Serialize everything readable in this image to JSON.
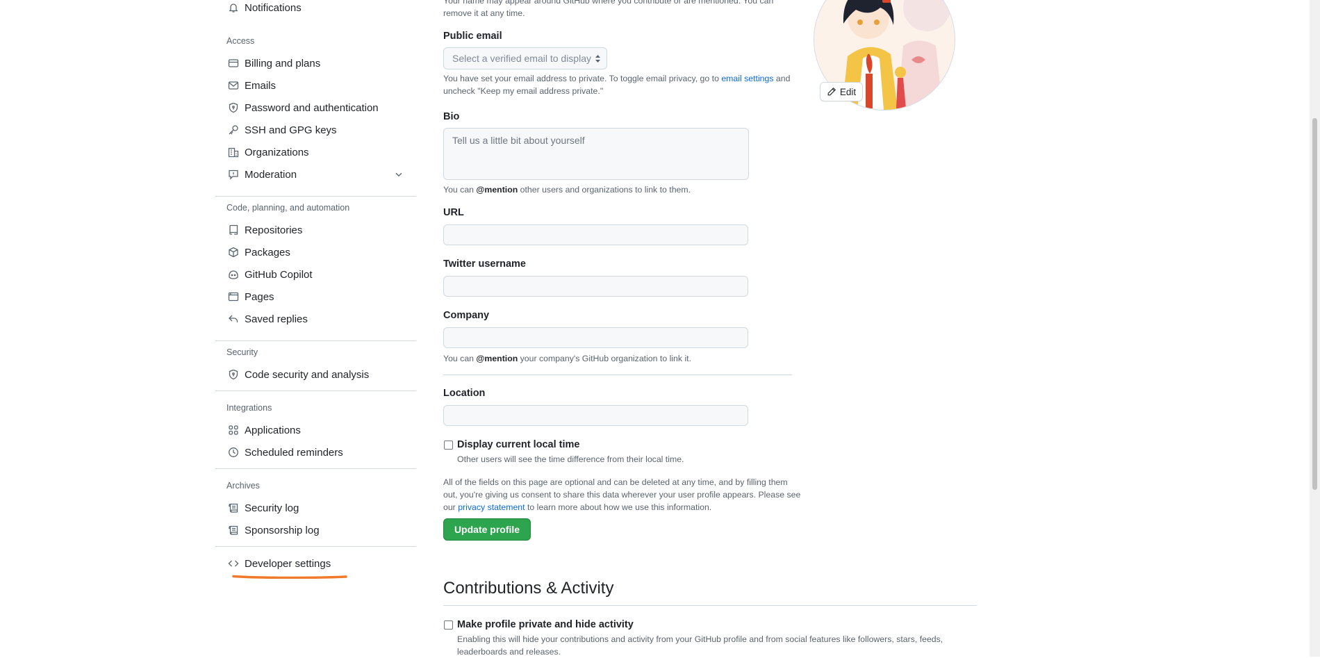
{
  "sidebar": {
    "top_items": [
      {
        "label": "Notifications",
        "icon": "bell-icon"
      }
    ],
    "groups": [
      {
        "title": "Access",
        "items": [
          {
            "label": "Billing and plans",
            "icon": "credit-card-icon"
          },
          {
            "label": "Emails",
            "icon": "mail-icon"
          },
          {
            "label": "Password and authentication",
            "icon": "shield-lock-icon"
          },
          {
            "label": "SSH and GPG keys",
            "icon": "key-icon"
          },
          {
            "label": "Organizations",
            "icon": "organization-icon"
          },
          {
            "label": "Moderation",
            "icon": "report-icon"
          }
        ]
      },
      {
        "title": "Code, planning, and automation",
        "items": [
          {
            "label": "Repositories",
            "icon": "repo-icon"
          },
          {
            "label": "Packages",
            "icon": "package-icon"
          },
          {
            "label": "GitHub Copilot",
            "icon": "copilot-icon"
          },
          {
            "label": "Pages",
            "icon": "browser-icon"
          },
          {
            "label": "Saved replies",
            "icon": "reply-icon"
          }
        ]
      },
      {
        "title": "Security",
        "items": [
          {
            "label": "Code security and analysis",
            "icon": "shield-lock-icon"
          }
        ]
      },
      {
        "title": "Integrations",
        "items": [
          {
            "label": "Applications",
            "icon": "apps-icon"
          },
          {
            "label": "Scheduled reminders",
            "icon": "clock-icon"
          }
        ]
      },
      {
        "title": "Archives",
        "items": [
          {
            "label": "Security log",
            "icon": "log-icon"
          },
          {
            "label": "Sponsorship log",
            "icon": "log-icon"
          }
        ]
      }
    ],
    "developer": {
      "label": "Developer settings",
      "icon": "code-icon"
    }
  },
  "form": {
    "name_note_line1": "Your name may appear around GitHub where you contribute or are mentioned. You can",
    "name_note_line2": "remove it at any time.",
    "public_email": {
      "label": "Public email",
      "selected": "Select a verified email to display",
      "note_line1_a": "You have set your email address to private. To toggle email privacy, go to ",
      "note_link": "email settings",
      "note_line1_b": " and",
      "note_line2": "uncheck \"Keep my email address private.\""
    },
    "bio": {
      "label": "Bio",
      "placeholder": "Tell us a little bit about yourself",
      "note_a": "You can ",
      "note_mention": "@mention",
      "note_b": " other users and organizations to link to them."
    },
    "url": {
      "label": "URL",
      "value": ""
    },
    "twitter": {
      "label": "Twitter username",
      "value": ""
    },
    "company": {
      "label": "Company",
      "value": "",
      "note_a": "You can ",
      "note_mention": "@mention",
      "note_b": " your company's GitHub organization to link it."
    },
    "location": {
      "label": "Location",
      "value": ""
    },
    "local_time": {
      "label": "Display current local time",
      "checked": false,
      "note": "Other users will see the time difference from their local time."
    },
    "consent_line1": "All of the fields on this page are optional and can be deleted at any time, and by filling them",
    "consent_line2": "out, you're giving us consent to share this data wherever your user profile appears. Please see",
    "consent_line3_a": "our ",
    "consent_link": "privacy statement",
    "consent_line3_b": " to learn more about how we use this information.",
    "update_button": "Update profile"
  },
  "contributions": {
    "heading": "Contributions & Activity",
    "private": {
      "label": "Make profile private and hide activity",
      "checked": false,
      "note_line1": "Enabling this will hide your contributions and activity from your GitHub profile and from social features like followers, stars, feeds,",
      "note_line2": "leaderboards and releases."
    }
  },
  "avatar": {
    "edit_label": "Edit"
  },
  "colors": {
    "primary_button": "#2da44e",
    "link": "#0969da",
    "annotation": "#f07a2a"
  }
}
